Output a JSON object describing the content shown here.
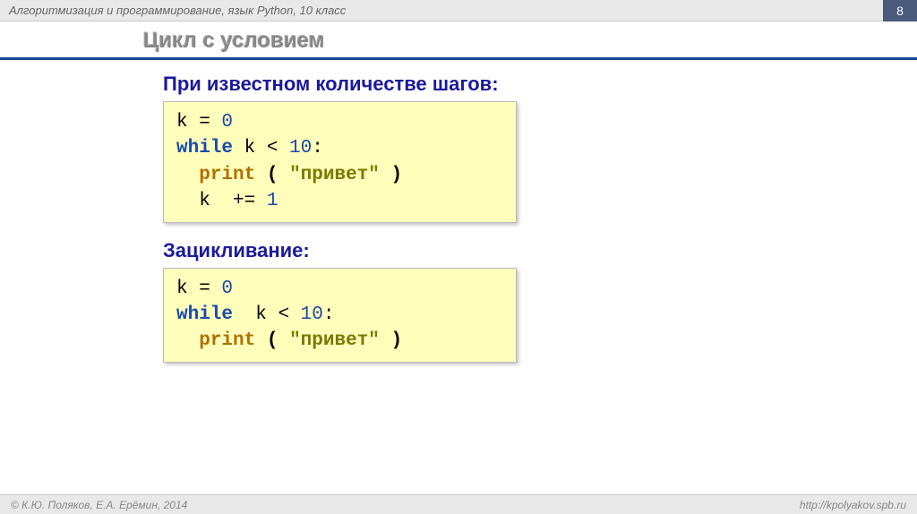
{
  "header": {
    "title": "Алгоритмизация и программирование, язык Python, 10 класс",
    "page_number": "8"
  },
  "slide": {
    "title": "Цикл с условием"
  },
  "section1": {
    "title": "При известном количестве шагов:",
    "code": {
      "l1_var": "k",
      "l1_eq": " = ",
      "l1_num": "0",
      "l2_kw": "while",
      "l2_var": " k ",
      "l2_lt": "< ",
      "l2_num": "10",
      "l2_colon": ":",
      "l3_indent": "  ",
      "l3_fn": "print",
      "l3_sp": " ",
      "l3_lp": "(",
      "l3_sp2": " ",
      "l3_str": "\"привет\"",
      "l3_sp3": " ",
      "l3_rp": ")",
      "l4_indent": "  ",
      "l4_var": "k ",
      "l4_op": " += ",
      "l4_num": "1"
    }
  },
  "section2": {
    "title": "Зацикливание:",
    "code": {
      "l1_var": "k",
      "l1_eq": " = ",
      "l1_num": "0",
      "l2_kw": "while",
      "l2_var": "  k ",
      "l2_lt": "< ",
      "l2_num": "10",
      "l2_colon": ":",
      "l3_indent": "  ",
      "l3_fn": "print",
      "l3_sp": " ",
      "l3_lp": "(",
      "l3_sp2": " ",
      "l3_str": "\"привет\"",
      "l3_sp3": " ",
      "l3_rp": ")"
    }
  },
  "footer": {
    "copyright": "© К.Ю. Поляков, Е.А. Ерёмин, 2014",
    "url": "http://kpolyakov.spb.ru"
  }
}
